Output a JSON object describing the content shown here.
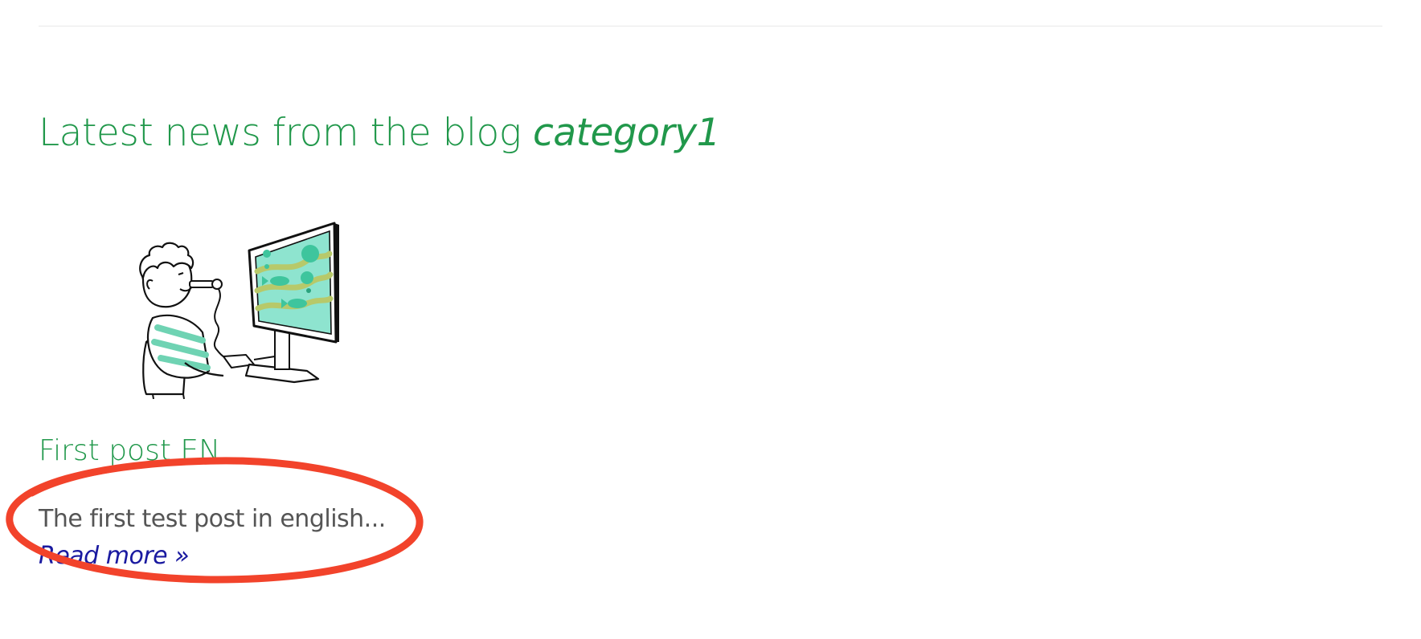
{
  "section": {
    "heading_prefix": "Latest news from the blog ",
    "heading_category": "category1"
  },
  "post": {
    "title": "First post EN",
    "excerpt": "The first test post in english...",
    "read_more_label": "Read more »",
    "thumbnail_icon": "person-using-mouth-controller-at-monitor-illustration"
  },
  "colors": {
    "heading": "#21984b",
    "excerpt": "#555555",
    "link": "#1a1aa0",
    "annotation": "#f2432b",
    "divider": "#e8e8e8"
  }
}
